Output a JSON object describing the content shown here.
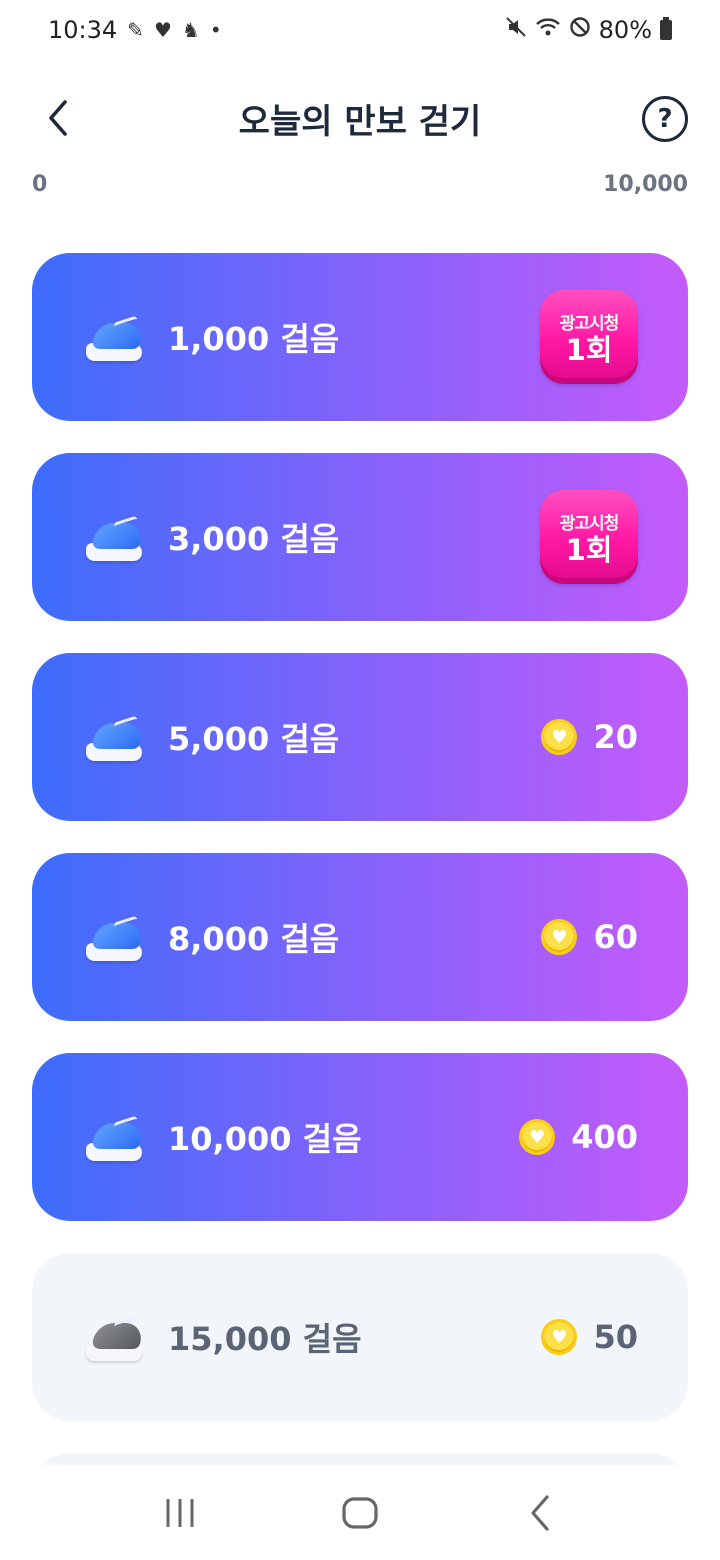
{
  "status_bar": {
    "time": "10:34",
    "left_icons": [
      "notification-icon",
      "health-heart-icon",
      "person-icon",
      "dot-icon"
    ],
    "right_icons": [
      "mute-icon",
      "wifi-icon",
      "block-icon"
    ],
    "battery": "80%"
  },
  "header": {
    "title": "오늘의 만보 걷기",
    "back_icon": "chevron-left-icon",
    "help_icon": "question-circle-icon",
    "help_glyph": "?"
  },
  "range": {
    "min": "0",
    "max": "10,000"
  },
  "cards": [
    {
      "steps": "1,000 걸음",
      "state": "active",
      "reward_type": "ad",
      "ad_line1": "광고시청",
      "ad_line2": "1회"
    },
    {
      "steps": "3,000 걸음",
      "state": "active",
      "reward_type": "ad",
      "ad_line1": "광고시청",
      "ad_line2": "1회"
    },
    {
      "steps": "5,000 걸음",
      "state": "active",
      "reward_type": "coin",
      "reward": "20"
    },
    {
      "steps": "8,000 걸음",
      "state": "active",
      "reward_type": "coin",
      "reward": "60"
    },
    {
      "steps": "10,000 걸음",
      "state": "active",
      "reward_type": "coin",
      "reward": "400"
    },
    {
      "steps": "15,000 걸음",
      "state": "inactive",
      "reward_type": "coin",
      "reward": "50"
    }
  ],
  "colors": {
    "gradient_start": "#3d6dfb",
    "gradient_end": "#c45bfb",
    "ad_badge": "#ff17a4",
    "coin": "#fde047",
    "inactive_bg": "#f2f5f9"
  },
  "nav_bar": {
    "icons": [
      "recent-apps-icon",
      "home-icon",
      "back-icon"
    ]
  }
}
